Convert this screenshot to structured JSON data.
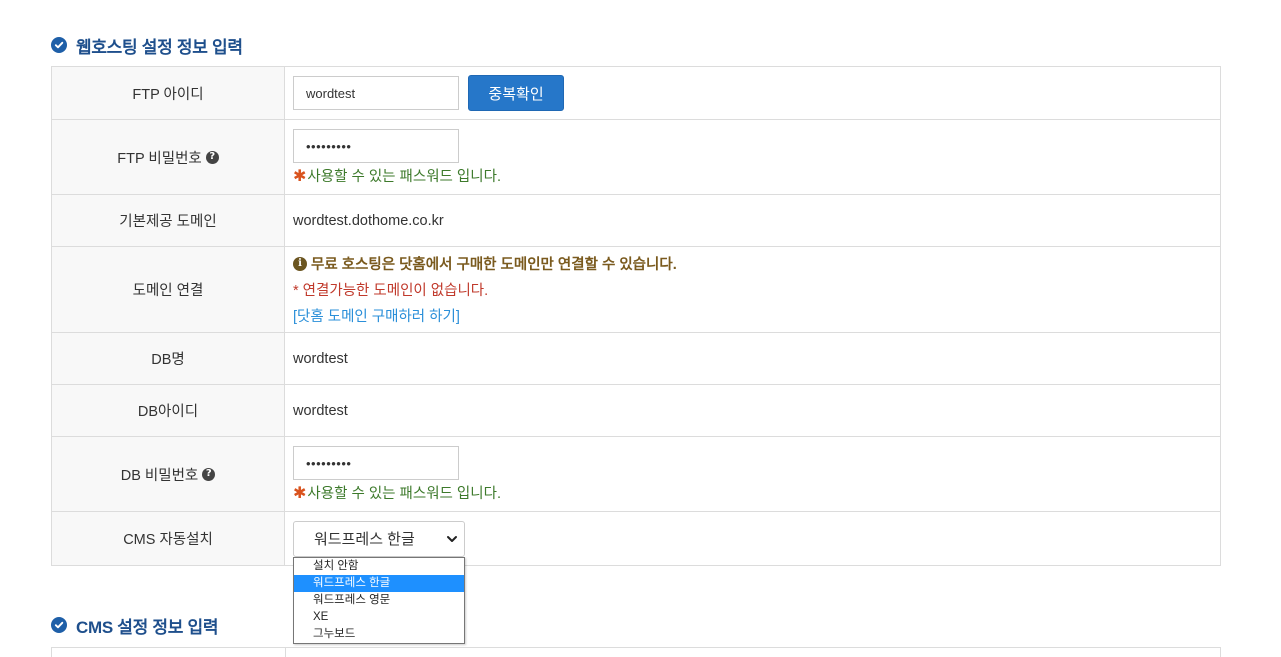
{
  "sections": {
    "hosting_title": "웹호스팅 설정 정보 입력",
    "cms_title": "CMS 설정 정보 입력"
  },
  "form": {
    "ftp_id": {
      "label": "FTP 아이디",
      "value": "wordtest",
      "button": "중복확인"
    },
    "ftp_pw": {
      "label": "FTP 비밀번호",
      "value": "•••••••••",
      "message": "사용할 수 있는 패스워드 입니다."
    },
    "default_domain": {
      "label": "기본제공 도메인",
      "value": "wordtest.dothome.co.kr"
    },
    "domain_link": {
      "label": "도메인 연결",
      "notice": "무료 호스팅은 닷홈에서 구매한 도메인만 연결할 수 있습니다.",
      "warning": "* 연결가능한 도메인이 없습니다.",
      "link": "[닷홈 도메인 구매하러 하기]"
    },
    "db_name": {
      "label": "DB명",
      "value": "wordtest"
    },
    "db_id": {
      "label": "DB아이디",
      "value": "wordtest"
    },
    "db_pw": {
      "label": "DB 비밀번호",
      "value": "•••••••••",
      "message": "사용할 수 있는 패스워드 입니다."
    },
    "cms": {
      "label": "CMS 자동설치",
      "selected": "워드프레스 한글",
      "options": [
        "설치 안함",
        "워드프레스 한글",
        "워드프레스 영문",
        "XE",
        "그누보드"
      ]
    }
  },
  "icons": {
    "section": "check-circle-icon",
    "help": "question-circle-icon",
    "info": "info-circle-icon",
    "required": "asterisk-icon",
    "select": "chevron-down-icon"
  },
  "colors": {
    "title": "#1e4f8c",
    "primary_button": "#2677c9",
    "success_text": "#3d7a2b",
    "warning_text": "#c0392b",
    "link_text": "#2a8fd9",
    "notice_text": "#7a5a1e",
    "dropdown_highlight": "#1e90ff"
  }
}
